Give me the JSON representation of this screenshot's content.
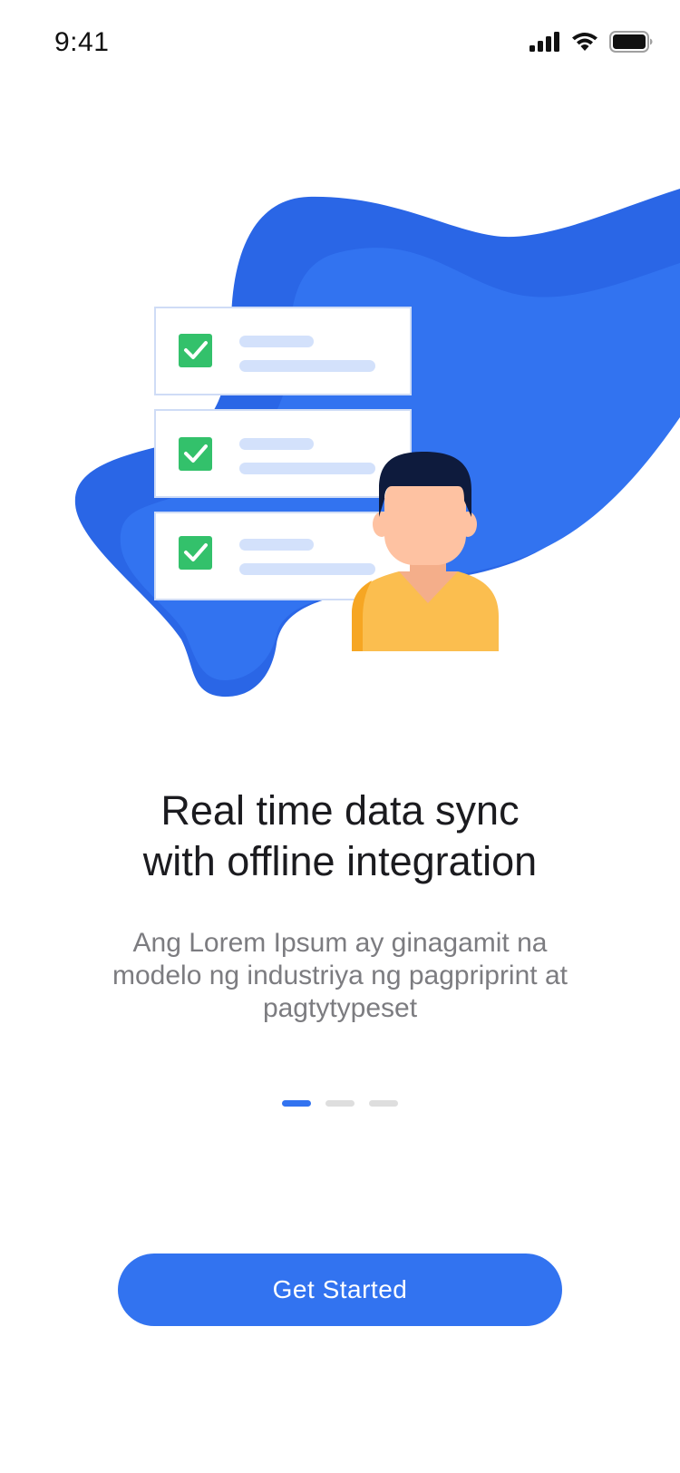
{
  "status_bar": {
    "time": "9:41",
    "icons": [
      "cellular-signal-icon",
      "wifi-icon",
      "battery-icon"
    ]
  },
  "onboarding": {
    "title_lines": [
      "Real time data sync",
      "with offline integration"
    ],
    "description_lines": [
      "Ang Lorem Ipsum ay ginagamit na",
      "modelo ng industriya ng pagpriprint at",
      "pagtytypeset"
    ],
    "pager": {
      "total": 3,
      "active_index": 0
    },
    "cta_label": "Get Started"
  },
  "colors": {
    "accent": "#3273F0",
    "check_green": "#33C16B",
    "shirt_yellow": "#FBBE4F",
    "hair_navy": "#0E1B3D",
    "skin": "#FEC2A2"
  }
}
